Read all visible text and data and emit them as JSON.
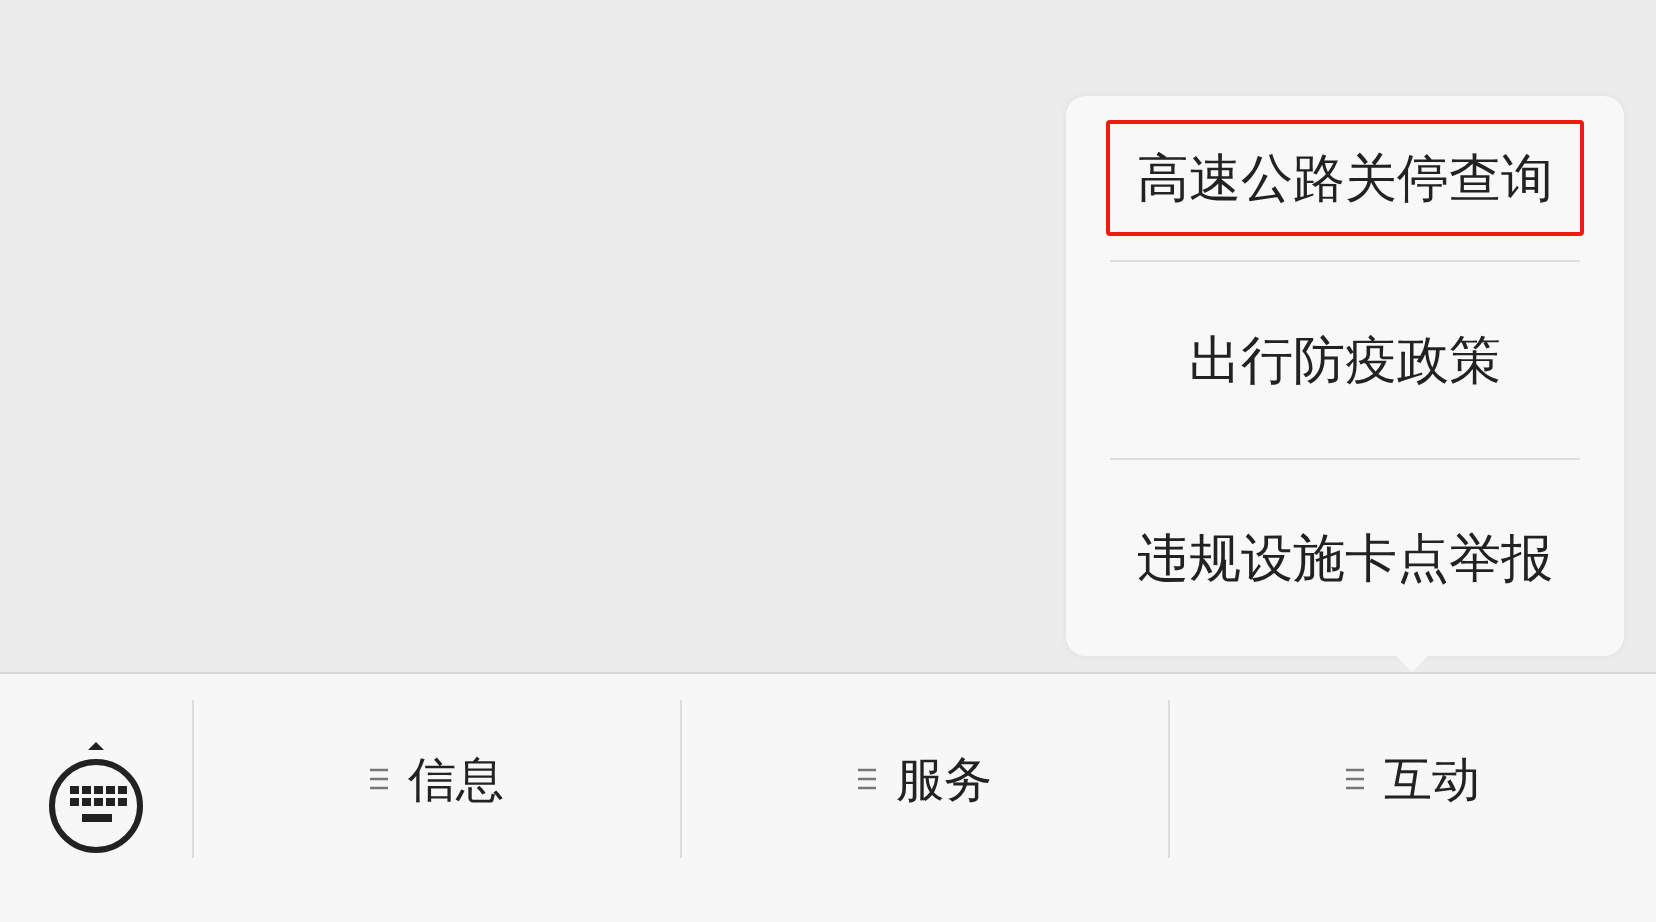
{
  "menu_bar": {
    "tabs": [
      {
        "label": "信息"
      },
      {
        "label": "服务"
      },
      {
        "label": "互动",
        "submenu": [
          {
            "label": "高速公路关停查询",
            "highlighted": true
          },
          {
            "label": "出行防疫政策",
            "highlighted": false
          },
          {
            "label": "违规设施卡点举报",
            "highlighted": false
          }
        ]
      }
    ]
  }
}
